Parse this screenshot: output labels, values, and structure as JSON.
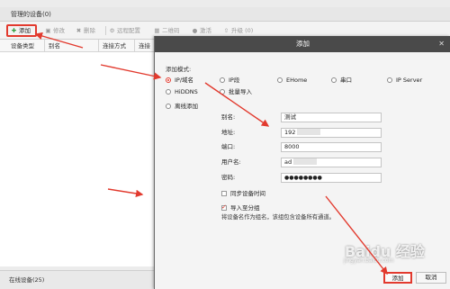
{
  "window": {
    "title": "管理的设备(0)"
  },
  "toolbar": {
    "add": "添加",
    "edit": "修改",
    "delete": "删除",
    "remote_config": "远程配置",
    "qr": "二维码",
    "activate": "激活",
    "upgrade": "升级 (0)"
  },
  "grid": {
    "columns": [
      "设备类型",
      "别名",
      "连接方式",
      "连接"
    ]
  },
  "bottom": {
    "online_devices": "在线设备(25)"
  },
  "dialog": {
    "title": "添加",
    "mode_label": "添加模式:",
    "modes": [
      {
        "label": "IP/域名",
        "selected": true
      },
      {
        "label": "IP段",
        "selected": false
      },
      {
        "label": "EHome",
        "selected": false
      },
      {
        "label": "串口",
        "selected": false
      },
      {
        "label": "IP Server",
        "selected": false
      },
      {
        "label": "HiDDNS",
        "selected": false
      },
      {
        "label": "批量导入",
        "selected": false
      },
      {
        "label": "离线添加",
        "selected": false
      }
    ],
    "fields": {
      "alias_label": "别名:",
      "alias_value": "测试",
      "address_label": "地址:",
      "address_value": "192",
      "port_label": "端口:",
      "port_value": "8000",
      "username_label": "用户名:",
      "username_value": "ad",
      "password_label": "密码:",
      "password_value": "●●●●●●●●"
    },
    "sync_time": {
      "label": "同步设备时间",
      "checked": false
    },
    "import_group": {
      "label": "导入至分组",
      "checked": true
    },
    "hint": "将设备名作为组名，该组包含设备所有通道。",
    "add_button": "添加",
    "cancel_button": "取消"
  },
  "watermark": {
    "main": "Baidu 经验",
    "sub": "jingyan.baidu.com"
  },
  "colors": {
    "accent_red": "#e23a2e",
    "dialog_title_bg": "#4a4a4a",
    "add_icon_green": "#2e9b3a"
  }
}
